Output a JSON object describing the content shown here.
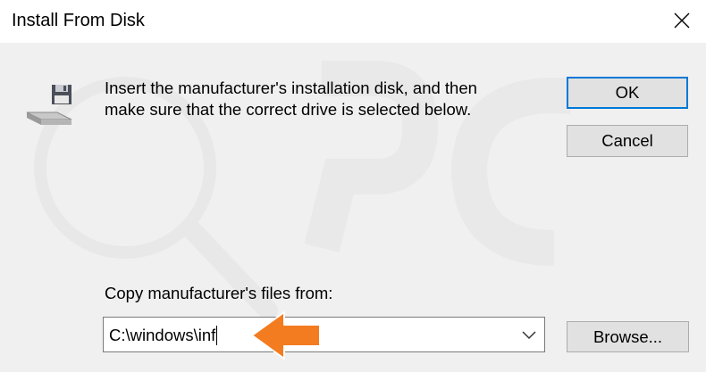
{
  "window": {
    "title": "Install From Disk",
    "close_glyph": "✕"
  },
  "dialog": {
    "instruction_line1": "Insert the manufacturer's installation disk, and then",
    "instruction_line2": "make sure that the correct drive is selected below.",
    "ok_label": "OK",
    "cancel_label": "Cancel",
    "copy_from_label": "Copy manufacturer's files from:",
    "path_value": "C:\\windows\\inf",
    "browse_label": "Browse..."
  },
  "icons": {
    "disk": "floppy-disk-drive-icon",
    "dropdown": "chevron-down-icon",
    "annotation": "orange-arrow-icon"
  },
  "colors": {
    "accent": "#0078d7",
    "dialog_bg": "#f0f0f0",
    "arrow": "#f47c20"
  }
}
